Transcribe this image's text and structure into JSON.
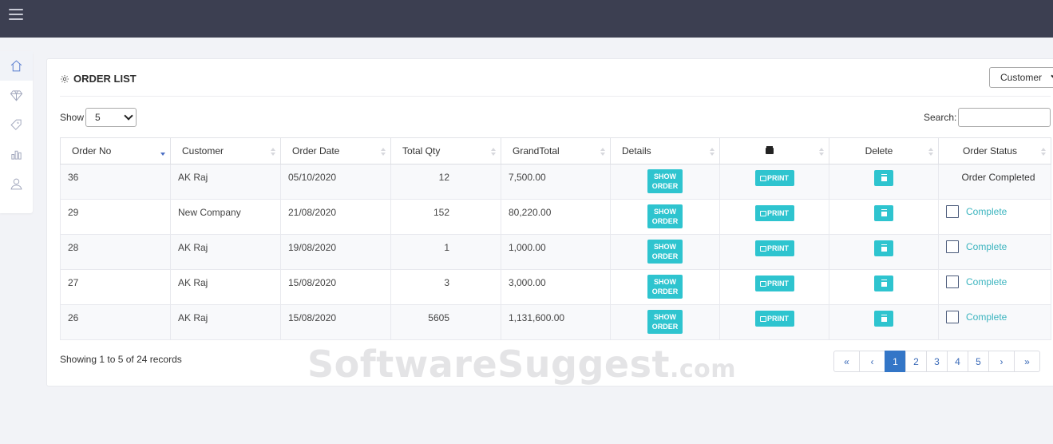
{
  "card": {
    "title": "ORDER LIST",
    "filter_select": "Customer"
  },
  "controls": {
    "show_label": "Show",
    "page_length": "5",
    "search_label": "Search:",
    "search_value": ""
  },
  "table": {
    "columns": [
      "Order No",
      "Customer",
      "Order Date",
      "Total Qty",
      "GrandTotal",
      "Details",
      "printer-icon",
      "Delete",
      "Order Status"
    ],
    "rows": [
      {
        "order_no": "36",
        "customer": "AK Raj",
        "date": "05/10/2020",
        "qty": "12",
        "total": "7,500.00",
        "status": "Order Completed",
        "completed": true
      },
      {
        "order_no": "29",
        "customer": "New Company",
        "date": "21/08/2020",
        "qty": "152",
        "total": "80,220.00",
        "status": "Complete",
        "completed": false
      },
      {
        "order_no": "28",
        "customer": "AK Raj",
        "date": "19/08/2020",
        "qty": "1",
        "total": "1,000.00",
        "status": "Complete",
        "completed": false
      },
      {
        "order_no": "27",
        "customer": "AK Raj",
        "date": "15/08/2020",
        "qty": "3",
        "total": "3,000.00",
        "status": "Complete",
        "completed": false
      },
      {
        "order_no": "26",
        "customer": "AK Raj",
        "date": "15/08/2020",
        "qty": "5605",
        "total": "1,131,600.00",
        "status": "Complete",
        "completed": false
      }
    ],
    "show_order_label": "SHOW ORDER",
    "print_label": "PRINT"
  },
  "footer": {
    "info": "Showing 1 to 5 of 24 records",
    "pages": [
      "«",
      "‹",
      "1",
      "2",
      "3",
      "4",
      "5",
      "›",
      "»"
    ],
    "active_page": "1"
  },
  "watermark": {
    "brand": "SoftwareSuggest",
    "suffix": ".com"
  },
  "sidebar": {
    "items": [
      "home-icon",
      "diamond-icon",
      "tags-icon",
      "bar-chart-icon",
      "user-icon"
    ]
  },
  "colors": {
    "topbar": "#3c3f51",
    "accent": "#2ec4cf",
    "pagination_active": "#3376c7"
  }
}
